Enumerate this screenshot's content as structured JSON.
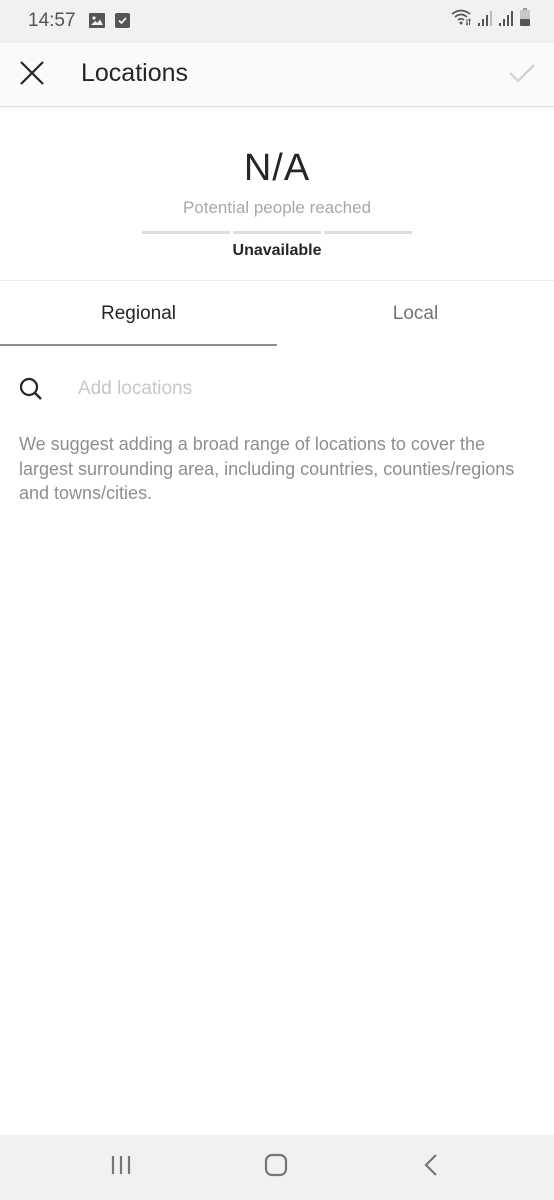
{
  "status_bar": {
    "time": "14:57",
    "left_icons": [
      "image-notification-icon",
      "checkbox-notification-icon"
    ],
    "right_icons": [
      "wifi-icon",
      "signal-icon-1",
      "signal-icon-2",
      "battery-icon"
    ]
  },
  "app_bar": {
    "title": "Locations",
    "close_icon": "close-icon",
    "done_icon": "checkmark-icon"
  },
  "reach": {
    "value": "N/A",
    "label": "Potential people reached",
    "status": "Unavailable",
    "bar_segments": 3
  },
  "tabs": [
    {
      "label": "Regional",
      "active": true
    },
    {
      "label": "Local",
      "active": false
    }
  ],
  "search": {
    "icon": "search-icon",
    "placeholder": "Add locations",
    "value": ""
  },
  "suggestion_text": "We suggest adding a broad range of locations to cover the largest surrounding area, including countries, counties/regions and towns/cities.",
  "nav_bar": {
    "buttons": [
      "recent-apps",
      "home",
      "back"
    ]
  },
  "colors": {
    "status_bar_bg": "#f1f1f1",
    "app_bar_bg": "#fafafa",
    "primary_text": "#262626",
    "secondary_text": "#8e8e8e",
    "placeholder": "#c7c7c7",
    "done_disabled": "#d0d0d0"
  }
}
